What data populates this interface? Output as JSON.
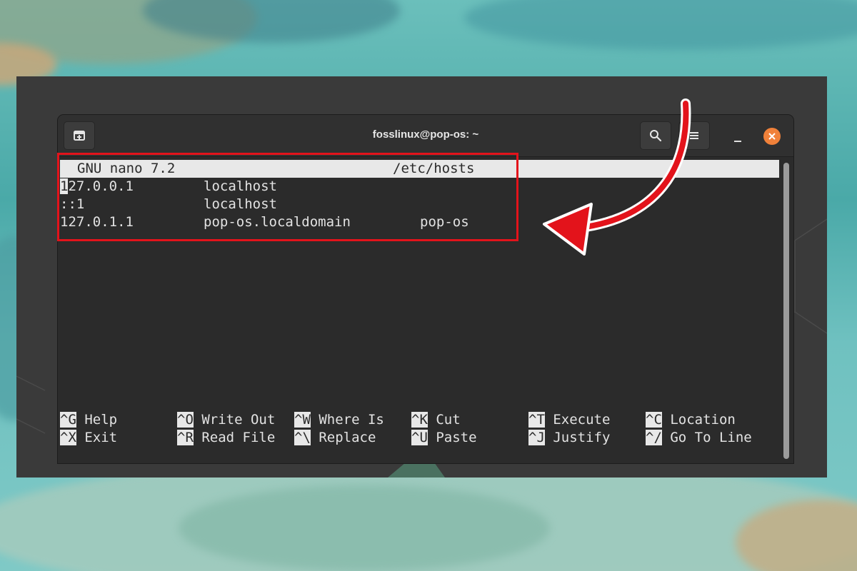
{
  "window": {
    "title": "fosslinux@pop-os: ~",
    "buttons": {
      "new_tab_icon": "new-tab-icon",
      "search_icon": "search-icon",
      "menu_icon": "hamburger-menu-icon",
      "minimize_icon": "minimize-icon",
      "close_icon": "close-icon",
      "close_color": "#f0813a"
    }
  },
  "nano": {
    "version": "GNU nano 7.2",
    "filename": "/etc/hosts",
    "lines": [
      {
        "cursor_char": "1",
        "rest": "27.0.0.1",
        "host": "localhost",
        "alias": ""
      },
      {
        "cursor_char": "",
        "rest": "::1",
        "host": "localhost",
        "alias": ""
      },
      {
        "cursor_char": "",
        "rest": "127.0.1.1",
        "host": "pop-os.localdomain",
        "alias": "pop-os"
      }
    ],
    "shortcuts": [
      {
        "key": "^G",
        "label": "Help"
      },
      {
        "key": "^O",
        "label": "Write Out"
      },
      {
        "key": "^W",
        "label": "Where Is"
      },
      {
        "key": "^K",
        "label": "Cut"
      },
      {
        "key": "^T",
        "label": "Execute"
      },
      {
        "key": "^C",
        "label": "Location"
      },
      {
        "key": "^X",
        "label": "Exit"
      },
      {
        "key": "^R",
        "label": "Read File"
      },
      {
        "key": "^\\",
        "label": "Replace"
      },
      {
        "key": "^U",
        "label": "Paste"
      },
      {
        "key": "^J",
        "label": "Justify"
      },
      {
        "key": "^/",
        "label": "Go To Line"
      }
    ]
  },
  "annotation": {
    "highlight_color": "#e3131b"
  }
}
